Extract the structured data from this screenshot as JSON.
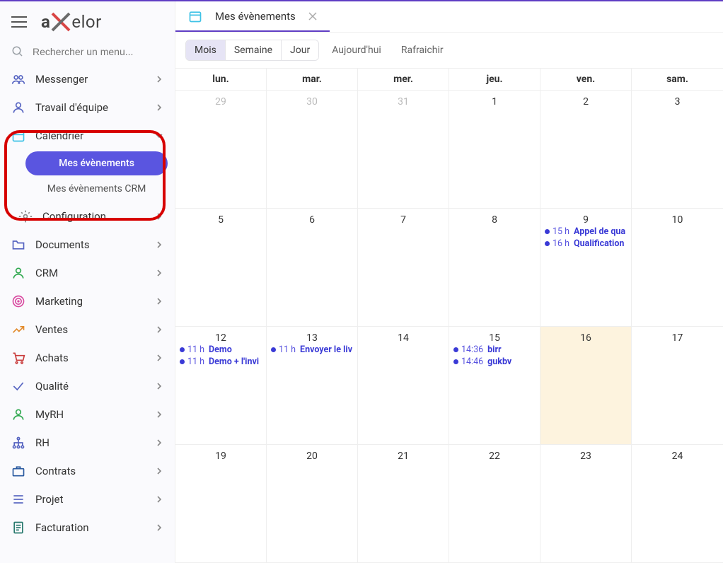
{
  "app": {
    "brand_prefix": "a",
    "brand_suffix": "elor"
  },
  "search": {
    "placeholder": "Rechercher un menu..."
  },
  "nav": {
    "items": [
      {
        "label": "Messenger",
        "icon": "users"
      },
      {
        "label": "Travail d'équipe",
        "icon": "user"
      },
      {
        "label": "Calendrier",
        "icon": "calendar",
        "expanded": true,
        "children": [
          {
            "label": "Mes évènements",
            "active": true
          },
          {
            "label": "Mes évènements CRM"
          }
        ]
      },
      {
        "label": "Configuration",
        "icon": "gear",
        "indented": true
      },
      {
        "label": "Documents",
        "icon": "folder"
      },
      {
        "label": "CRM",
        "icon": "person-green"
      },
      {
        "label": "Marketing",
        "icon": "target"
      },
      {
        "label": "Ventes",
        "icon": "trend"
      },
      {
        "label": "Achats",
        "icon": "cart"
      },
      {
        "label": "Qualité",
        "icon": "check"
      },
      {
        "label": "MyRH",
        "icon": "person-green"
      },
      {
        "label": "RH",
        "icon": "org"
      },
      {
        "label": "Contrats",
        "icon": "briefcase"
      },
      {
        "label": "Projet",
        "icon": "list"
      },
      {
        "label": "Facturation",
        "icon": "doc"
      }
    ]
  },
  "tab": {
    "title": "Mes évènements"
  },
  "toolbar": {
    "views": [
      "Mois",
      "Semaine",
      "Jour"
    ],
    "active_view": 0,
    "today": "Aujourd'hui",
    "refresh": "Rafraichir"
  },
  "calendar": {
    "day_headers": [
      "lun.",
      "mar.",
      "mer.",
      "jeu.",
      "ven.",
      "sam."
    ],
    "weeks": [
      [
        {
          "day": "29",
          "muted": true
        },
        {
          "day": "30",
          "muted": true
        },
        {
          "day": "31",
          "muted": true
        },
        {
          "day": "1"
        },
        {
          "day": "2"
        },
        {
          "day": "3"
        }
      ],
      [
        {
          "day": "5"
        },
        {
          "day": "6"
        },
        {
          "day": "7"
        },
        {
          "day": "8"
        },
        {
          "day": "9",
          "events": [
            {
              "time": "15 h",
              "title": "Appel de qua"
            },
            {
              "time": "16 h",
              "title": "Qualification"
            }
          ]
        },
        {
          "day": "10"
        }
      ],
      [
        {
          "day": "12",
          "events": [
            {
              "time": "11 h",
              "title": "Demo"
            },
            {
              "time": "11 h",
              "title": "Demo + l'invi"
            }
          ]
        },
        {
          "day": "13",
          "events": [
            {
              "time": "11 h",
              "title": "Envoyer le liv"
            }
          ]
        },
        {
          "day": "14"
        },
        {
          "day": "15",
          "events": [
            {
              "time": "14:36",
              "title": "birr"
            },
            {
              "time": "14:46",
              "title": "gukbv"
            }
          ]
        },
        {
          "day": "16",
          "today": true
        },
        {
          "day": "17"
        }
      ],
      [
        {
          "day": "19"
        },
        {
          "day": "20"
        },
        {
          "day": "21"
        },
        {
          "day": "22"
        },
        {
          "day": "23"
        },
        {
          "day": "24"
        }
      ]
    ]
  }
}
